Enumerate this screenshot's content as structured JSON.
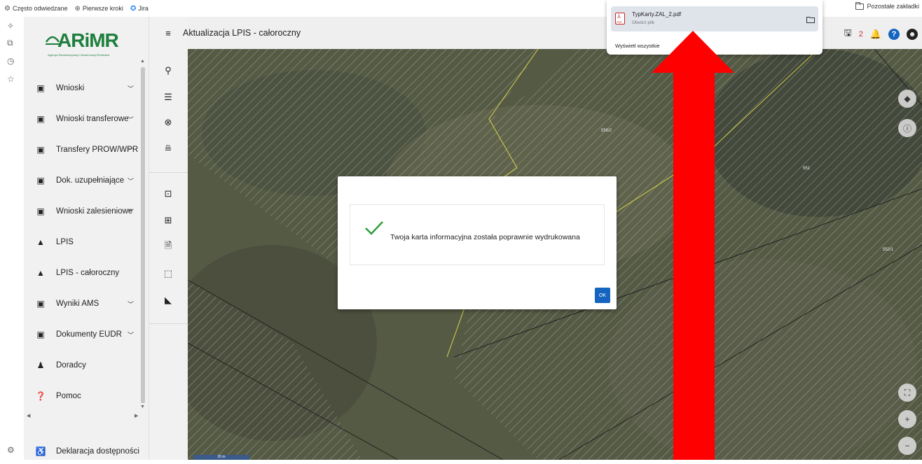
{
  "bookmarks": {
    "items": [
      {
        "icon": "gear-icon",
        "label": "Często odwiedzane"
      },
      {
        "icon": "globe-icon",
        "label": "Pierwsze kroki"
      },
      {
        "icon": "jira-icon",
        "label": "Jira"
      }
    ],
    "other_label": "Pozostałe zakładki"
  },
  "sidebar": {
    "logo_text": "ARiMR",
    "logo_sub": "Agencja Restrukturyzacji i Modernizacji Rolnictwa",
    "items": [
      {
        "label": "Wnioski",
        "icon": "clipboard-icon",
        "has_chevron": true
      },
      {
        "label": "Wnioski transferowe",
        "icon": "clipboard-icon",
        "has_chevron": true
      },
      {
        "label": "Transfery PROW/WPR",
        "icon": "clipboard-icon",
        "has_chevron": true
      },
      {
        "label": "Dok. uzupełniające",
        "icon": "clipboard-icon",
        "has_chevron": true
      },
      {
        "label": "Wnioski zalesieniowe",
        "icon": "clipboard-icon",
        "has_chevron": true
      },
      {
        "label": "LPIS",
        "icon": "mountain-icon",
        "has_chevron": false
      },
      {
        "label": "LPIS - całoroczny",
        "icon": "mountain-icon",
        "has_chevron": false
      },
      {
        "label": "Wyniki AMS",
        "icon": "clipboard-icon",
        "has_chevron": true
      },
      {
        "label": "Dokumenty EUDR",
        "icon": "clipboard-icon",
        "has_chevron": true
      },
      {
        "label": "Doradcy",
        "icon": "person-icon",
        "has_chevron": false
      },
      {
        "label": "Pomoc",
        "icon": "help-icon",
        "has_chevron": false
      }
    ],
    "footer_item": {
      "label": "Deklaracja dostępności",
      "icon": "accessibility-icon"
    }
  },
  "header": {
    "title": "Aktualizacja LPIS - całoroczny",
    "notification_count": "2"
  },
  "map": {
    "parcels": [
      "558/2",
      "551",
      "552/1"
    ],
    "scale_label": "20 m"
  },
  "dialog": {
    "message": "Twoja karta informacyjna została poprawnie wydrukowana",
    "ok_label": "OK"
  },
  "downloads": {
    "file_name": "TypKarty.ZAL_2.pdf",
    "file_action": "Otwórz plik",
    "show_all": "Wyświetl wszystkie"
  },
  "colors": {
    "brand_green": "#1e7f3c",
    "primary_blue": "#1565c0",
    "alert_red": "#d32f2f",
    "arrow_red": "#ff0000"
  }
}
